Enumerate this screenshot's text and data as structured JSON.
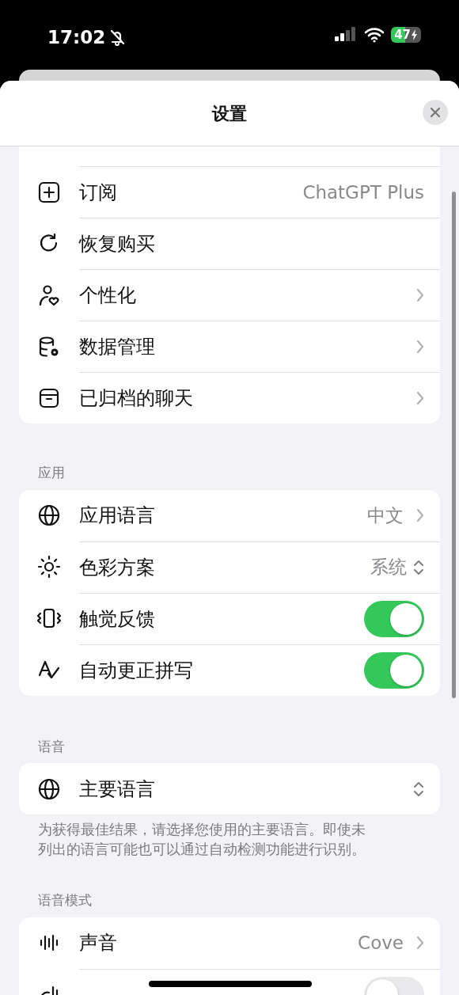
{
  "status_bar": {
    "time": "17:02",
    "battery": "47"
  },
  "sheet": {
    "title": "设置"
  },
  "sections": [
    {
      "items": [
        {
          "kind": "detail",
          "label": "订阅",
          "value": "ChatGPT Plus"
        },
        {
          "kind": "action",
          "label": "恢复购买"
        },
        {
          "kind": "link",
          "label": "个性化"
        },
        {
          "kind": "link",
          "label": "数据管理"
        },
        {
          "kind": "link",
          "label": "已归档的聊天"
        }
      ]
    },
    {
      "header": "应用",
      "items": [
        {
          "kind": "link",
          "label": "应用语言",
          "value": "中文"
        },
        {
          "kind": "picker",
          "label": "色彩方案",
          "value": "系统"
        },
        {
          "kind": "switch",
          "label": "触觉反馈",
          "on": true
        },
        {
          "kind": "switch",
          "label": "自动更正拼写",
          "on": true
        }
      ]
    },
    {
      "header": "语音",
      "items": [
        {
          "kind": "picker",
          "label": "主要语言"
        }
      ],
      "footer": "为获得最佳结果，请选择您使用的主要语言。即使未列出的语言可能也可以通过自动检测功能进行识别。"
    },
    {
      "header": "语音模式",
      "items": [
        {
          "kind": "link",
          "label": "声音",
          "value": "Cove"
        },
        {
          "kind": "switch",
          "on": false
        }
      ]
    }
  ]
}
